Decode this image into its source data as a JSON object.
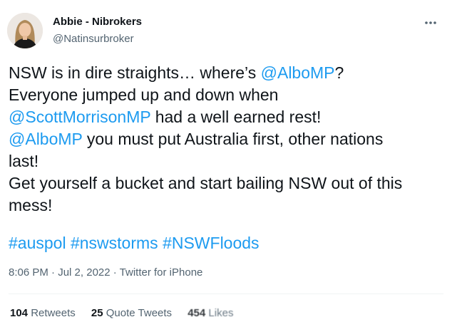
{
  "author": {
    "display_name": "Abbie - Nibrokers",
    "handle": "@Natinsurbroker"
  },
  "menu_icon": "more-dots-icon",
  "tweet_lines": [
    [
      {
        "t": "NSW is in dire straights… where’s ",
        "type": "text"
      },
      {
        "t": "@AlboMP",
        "type": "mention"
      },
      {
        "t": "?",
        "type": "text"
      }
    ],
    [
      {
        "t": "Everyone jumped up and down when",
        "type": "text"
      }
    ],
    [
      {
        "t": "@ScottMorrisonMP",
        "type": "mention"
      },
      {
        "t": " had a well earned rest!",
        "type": "text"
      }
    ],
    [
      {
        "t": "@AlboMP",
        "type": "mention"
      },
      {
        "t": " you must put Australia first, other nations",
        "type": "text"
      }
    ],
    [
      {
        "t": "last!",
        "type": "text"
      }
    ],
    [
      {
        "t": "Get yourself a bucket and start bailing NSW out of this",
        "type": "text"
      }
    ],
    [
      {
        "t": "mess!",
        "type": "text"
      }
    ]
  ],
  "hashtags": [
    "#auspol",
    "#nswstorms",
    "#NSWFloods"
  ],
  "meta": {
    "time": "8:06 PM",
    "separator": " · ",
    "date": "Jul 2, 2022",
    "source": "Twitter for iPhone"
  },
  "stats": {
    "retweets": {
      "num": "104",
      "label": "Retweets"
    },
    "quotes": {
      "num": "25",
      "label": "Quote Tweets"
    },
    "likes": {
      "num": "454",
      "label": "Likes"
    }
  },
  "colors": {
    "link": "#1d9bf0",
    "secondary_text": "#536471",
    "primary_text": "#0f1419"
  }
}
